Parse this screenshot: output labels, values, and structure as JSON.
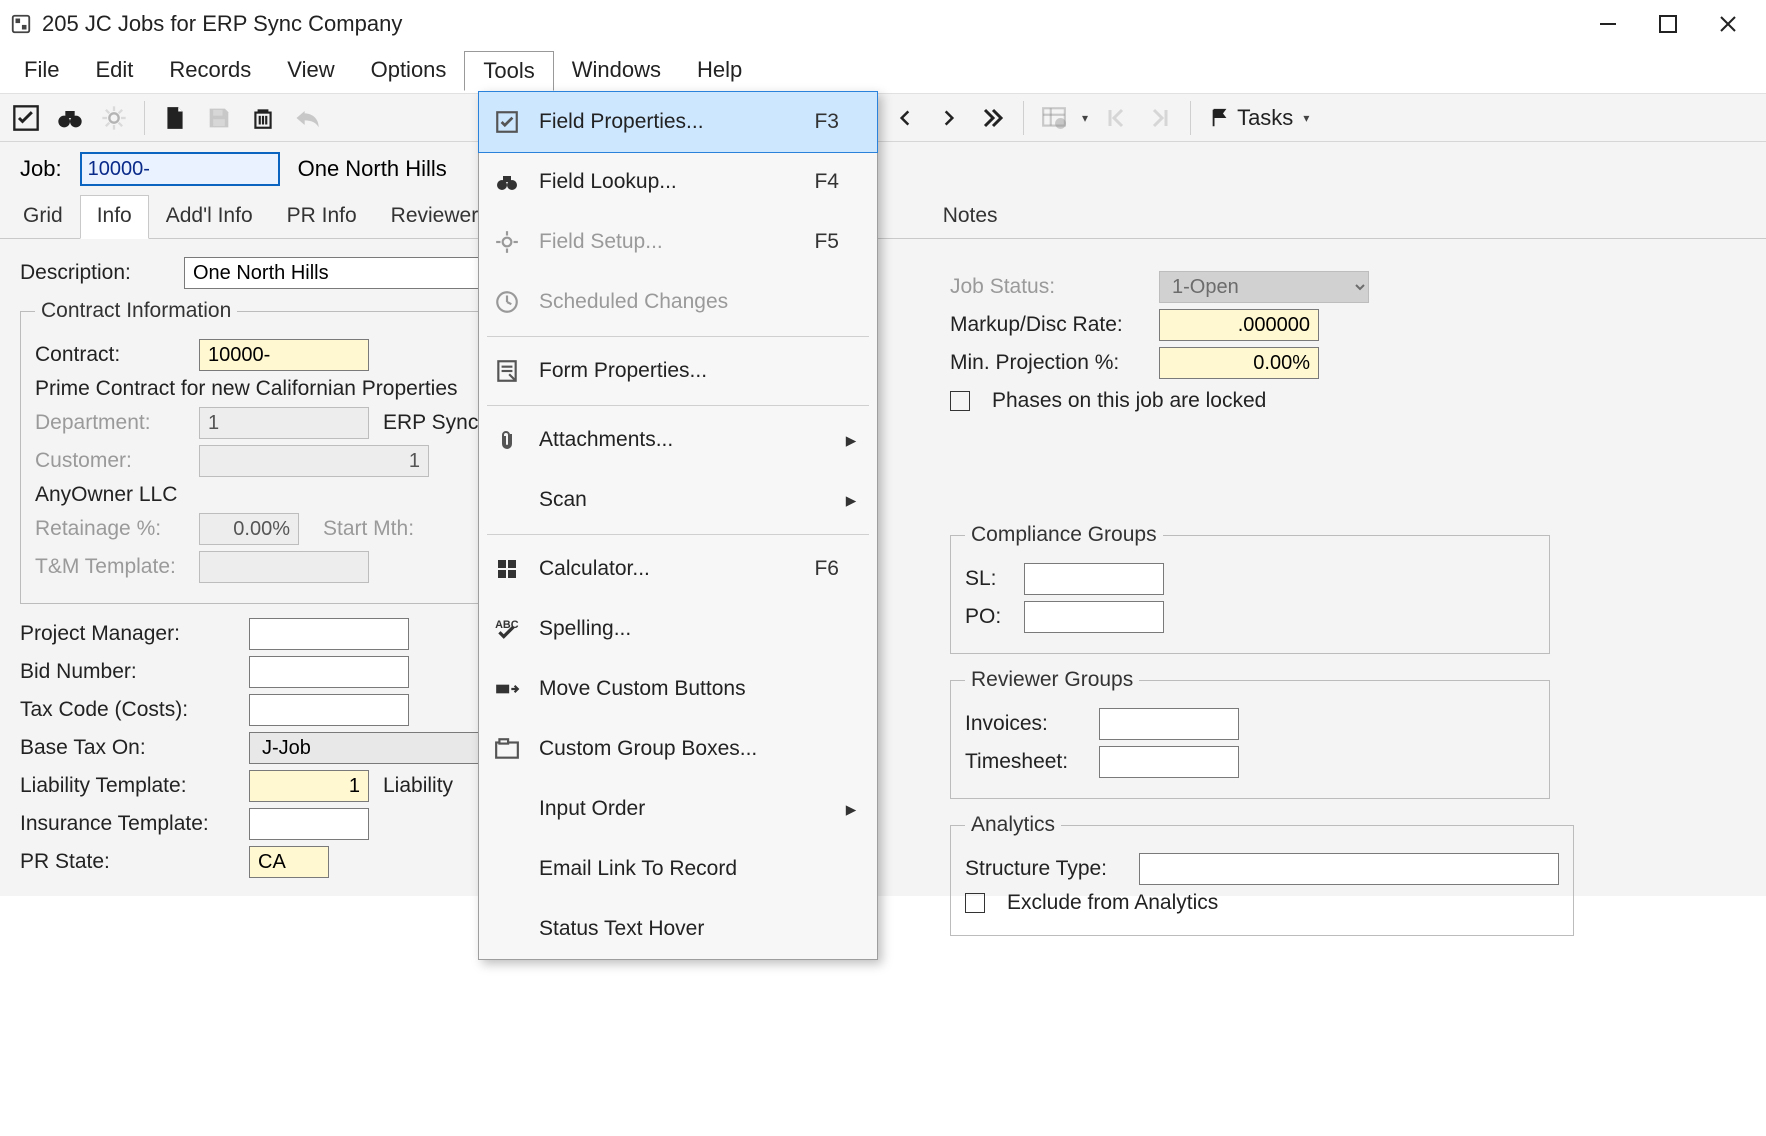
{
  "window": {
    "title": "205 JC Jobs for ERP Sync Company"
  },
  "menubar": [
    "File",
    "Edit",
    "Records",
    "View",
    "Options",
    "Tools",
    "Windows",
    "Help"
  ],
  "tools_menu": [
    {
      "label": "Field Properties...",
      "shortcut": "F3",
      "icon": "properties",
      "selected": true
    },
    {
      "label": "Field Lookup...",
      "shortcut": "F4",
      "icon": "binoculars"
    },
    {
      "label": "Field Setup...",
      "shortcut": "F5",
      "icon": "gear",
      "disabled": true
    },
    {
      "label": "Scheduled Changes",
      "icon": "clock",
      "disabled": true
    },
    {
      "sep": true
    },
    {
      "label": "Form Properties...",
      "icon": "form"
    },
    {
      "sep": true
    },
    {
      "label": "Attachments...",
      "icon": "paperclip",
      "submenu": true
    },
    {
      "label": "Scan",
      "submenu": true
    },
    {
      "sep": true
    },
    {
      "label": "Calculator...",
      "shortcut": "F6",
      "icon": "calculator"
    },
    {
      "label": "Spelling...",
      "icon": "spellcheck"
    },
    {
      "label": "Move Custom Buttons",
      "icon": "move"
    },
    {
      "label": "Custom Group Boxes...",
      "icon": "groupbox"
    },
    {
      "label": "Input Order",
      "submenu": true
    },
    {
      "label": "Email Link To Record"
    },
    {
      "label": "Status Text Hover"
    }
  ],
  "tasks_label": "Tasks",
  "job": {
    "label": "Job:",
    "value": "10000-",
    "name": "One North Hills"
  },
  "tabs": [
    "Grid",
    "Info",
    "Add'l Info",
    "PR Info",
    "Reviewers",
    "Notes"
  ],
  "active_tab": "Info",
  "description": {
    "label": "Description:",
    "value": "One North Hills"
  },
  "contract_group": {
    "legend": "Contract Information",
    "contract_label": "Contract:",
    "contract_value": "10000-",
    "contract_desc": "Prime Contract for new Californian Properties",
    "department_label": "Department:",
    "department_value": "1",
    "department_name": "ERP Sync",
    "customer_label": "Customer:",
    "customer_value": "1",
    "customer_name": "AnyOwner LLC",
    "retainage_label": "Retainage %:",
    "retainage_value": "0.00%",
    "startmth_label": "Start Mth:",
    "tm_label": "T&M Template:"
  },
  "left_fields": {
    "pm_label": "Project Manager:",
    "bid_label": "Bid Number:",
    "tax_label": "Tax Code (Costs):",
    "basetax_label": "Base Tax On:",
    "basetax_value": "J-Job",
    "liab_label": "Liability Template:",
    "liab_value": "1",
    "liab_after": "Liability",
    "ins_label": "Insurance Template:",
    "prstate_label": "PR State:",
    "prstate_value": "CA"
  },
  "right_fields": {
    "status_label": "Job Status:",
    "status_value": "1-Open",
    "markup_label": "Markup/Disc Rate:",
    "markup_value": ".000000",
    "minproj_label": "Min. Projection %:",
    "minproj_value": "0.00%",
    "phases_locked": "Phases on this job are locked"
  },
  "compliance": {
    "legend": "Compliance Groups",
    "sl": "SL:",
    "po": "PO:"
  },
  "reviewer": {
    "legend": "Reviewer Groups",
    "inv": "Invoices:",
    "ts": "Timesheet:"
  },
  "analytics": {
    "legend": "Analytics",
    "struct": "Structure Type:",
    "exclude": "Exclude from Analytics"
  }
}
